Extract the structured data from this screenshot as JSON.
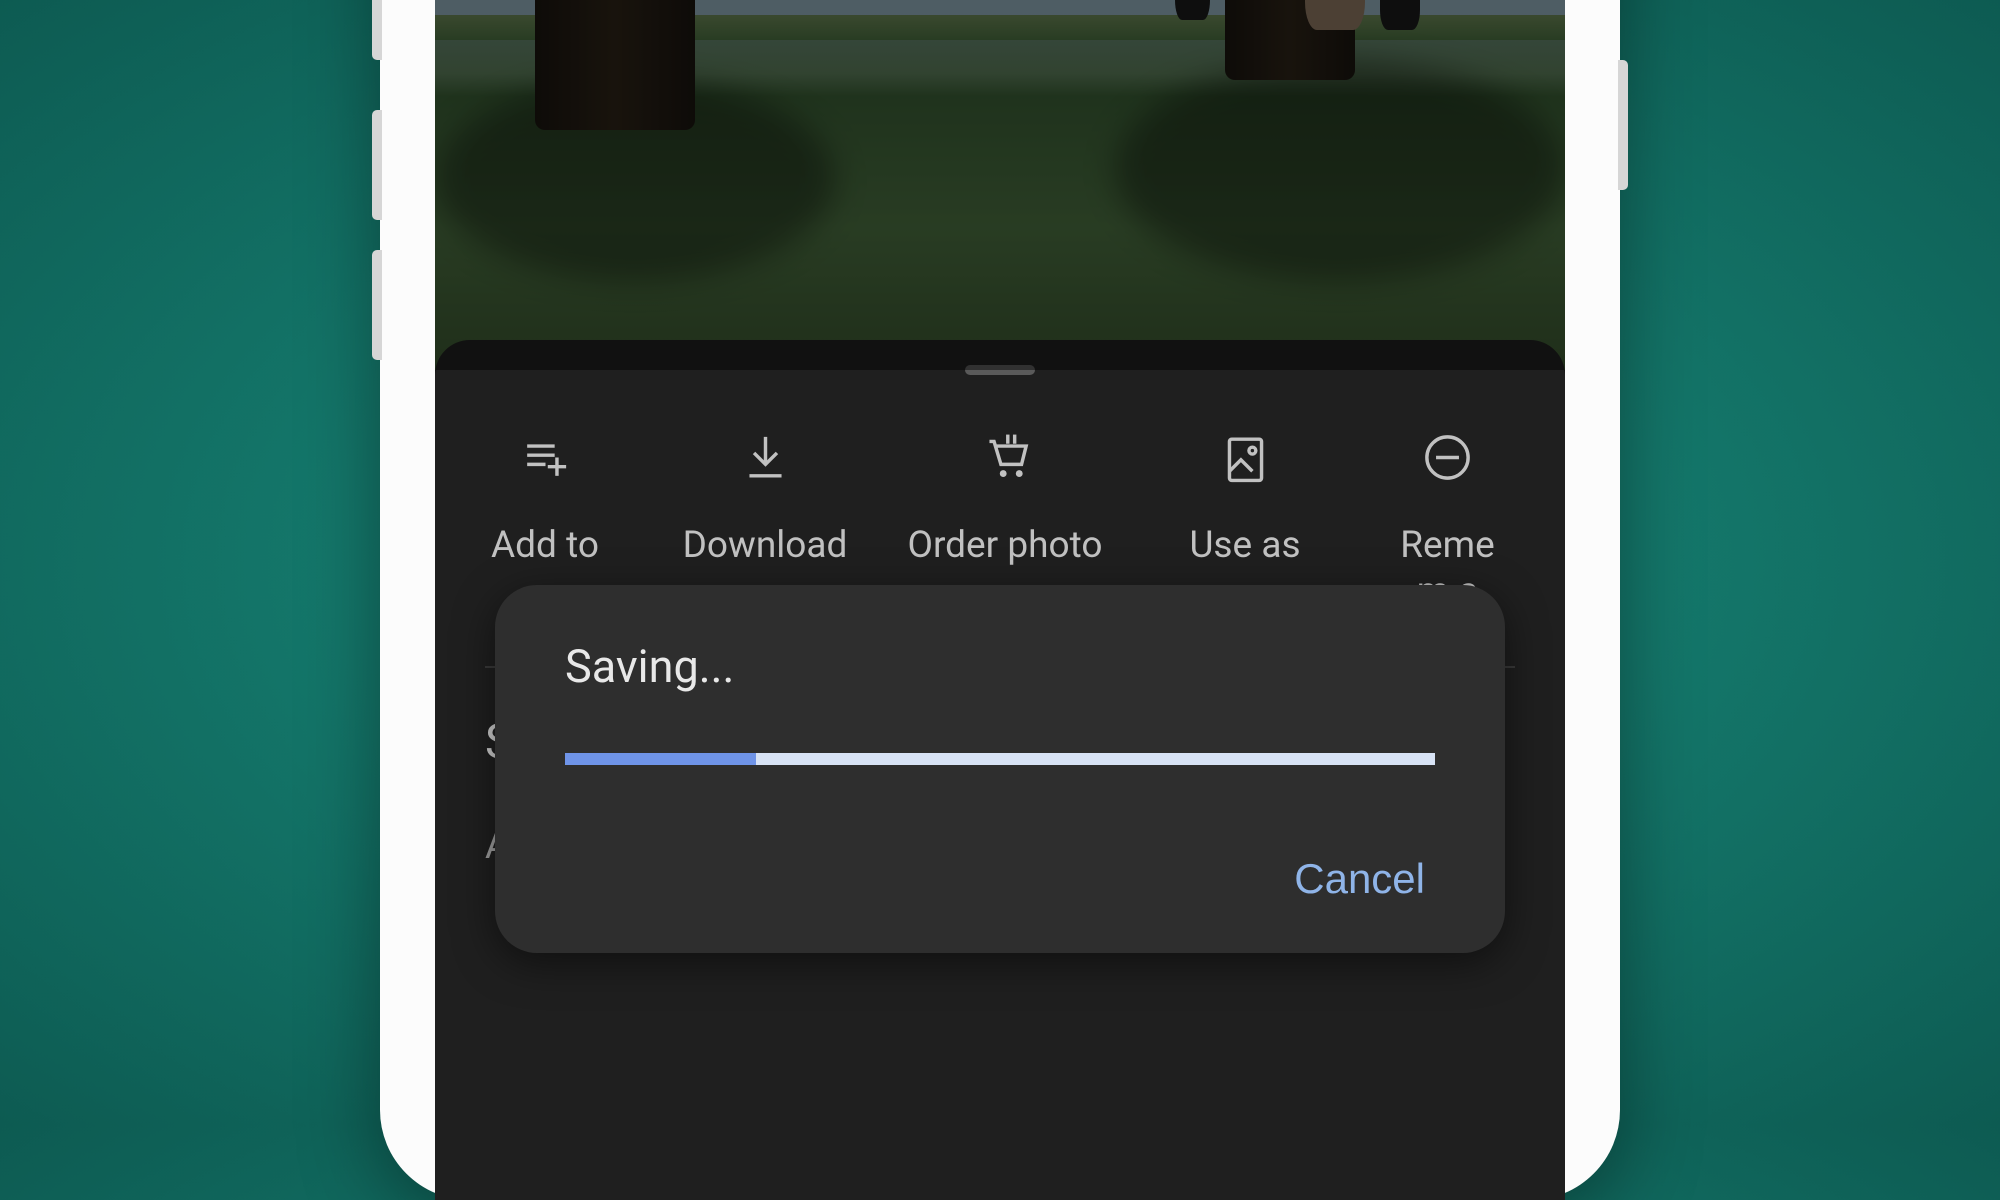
{
  "actions": [
    {
      "label": "Add to"
    },
    {
      "label": "Download"
    },
    {
      "label": "Order photo"
    },
    {
      "label": "Use as"
    },
    {
      "label": "Reme\nm a"
    }
  ],
  "obscured": {
    "char1": "S",
    "char2": "A"
  },
  "dialog": {
    "title": "Saving...",
    "progress_percent": 22,
    "cancel": "Cancel"
  },
  "colors": {
    "accent": "#6f94e8",
    "cancel_text": "#8fb4e8"
  }
}
